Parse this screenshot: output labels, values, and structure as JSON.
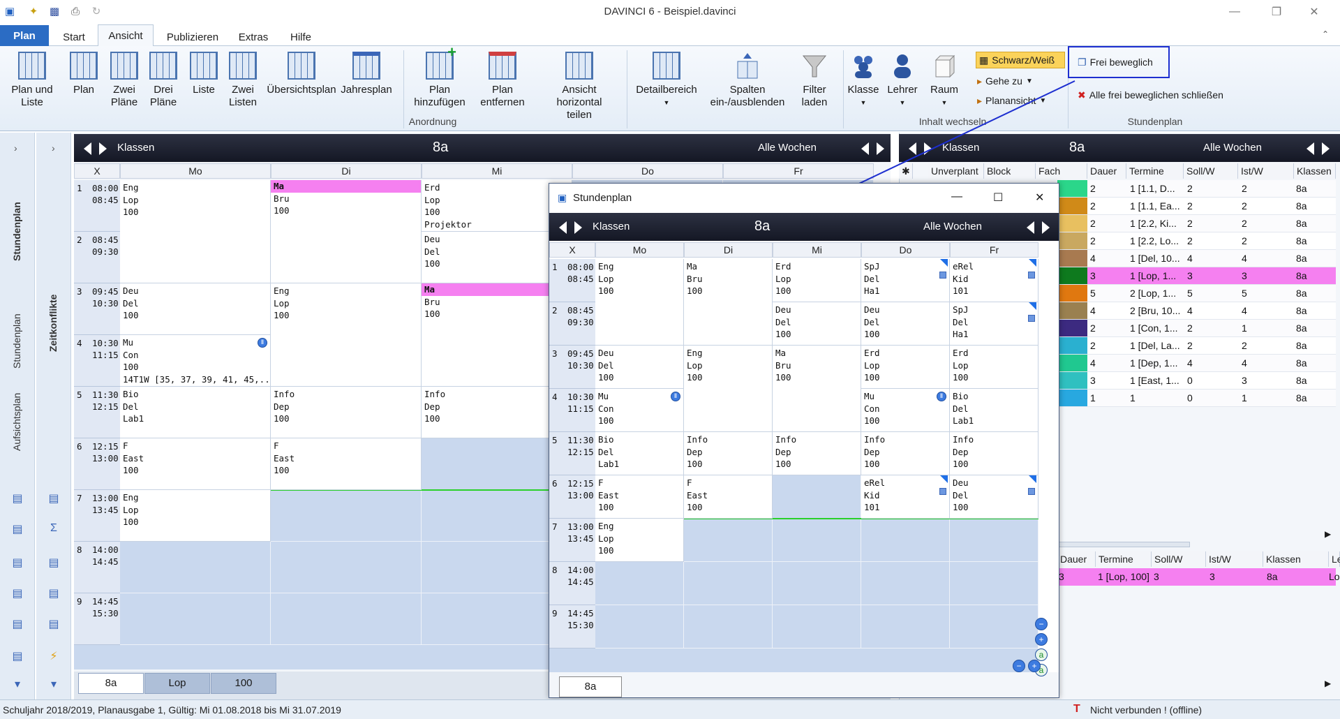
{
  "window": {
    "title": "DAVINCI 6 - Beispiel.davinci",
    "minimize": "—",
    "maximize": "❐",
    "close": "✕"
  },
  "tabs": [
    {
      "label": "Plan"
    },
    {
      "label": "Start"
    },
    {
      "label": "Ansicht"
    },
    {
      "label": "Publizieren"
    },
    {
      "label": "Extras"
    },
    {
      "label": "Hilfe"
    }
  ],
  "ribbon": {
    "buttons": [
      "Plan und\nListe",
      "Plan",
      "Zwei\nPläne",
      "Drei\nPläne",
      "Liste",
      "Zwei\nListen",
      "Übersichtsplan",
      "Jahresplan",
      "Plan\nhinzufügen",
      "Plan\nentfernen",
      "Ansicht\nhorizontal teilen",
      "Detailbereich",
      "Spalten\nein-/ausblenden",
      "Filter\nladen",
      "Klasse",
      "Lehrer",
      "Raum"
    ],
    "group_anordnung": "Anordnung",
    "group_inhalt": "Inhalt wechseln",
    "group_stundenplan": "Stundenplan",
    "schwarz_weiss": "Schwarz/Weiß",
    "gehe_zu": "Gehe zu",
    "planansicht": "Planansicht",
    "frei_beweglich": "Frei beweglich",
    "alle_frei": "Alle frei beweglichen schließen"
  },
  "left": {
    "stundenplan": "Stundenplan",
    "aufsichtsplan": "Aufsichtsplan",
    "stundenplan2": "Stundenplan",
    "zeitkonflikte": "Zeitkonflikte"
  },
  "main": {
    "kind": "Klassen",
    "name": "8a",
    "weeks": "Alle Wochen",
    "days": [
      "X",
      "Mo",
      "Di",
      "Mi",
      "Do",
      "Fr"
    ],
    "slots": [
      {
        "n": "1",
        "from": "08:00",
        "to": "08:45"
      },
      {
        "n": "2",
        "from": "08:45",
        "to": "09:30"
      },
      {
        "n": "3",
        "from": "09:45",
        "to": "10:30"
      },
      {
        "n": "4",
        "from": "10:30",
        "to": "11:15"
      },
      {
        "n": "5",
        "from": "11:30",
        "to": "12:15"
      },
      {
        "n": "6",
        "from": "12:15",
        "to": "13:00"
      },
      {
        "n": "7",
        "from": "13:00",
        "to": "13:45"
      },
      {
        "n": "8",
        "from": "14:00",
        "to": "14:45"
      },
      {
        "n": "9",
        "from": "14:45",
        "to": "15:30"
      }
    ],
    "lessons": [
      {
        "d": 0,
        "s": 0,
        "h": 2,
        "lines": [
          "Eng",
          "Lop",
          "100"
        ]
      },
      {
        "d": 1,
        "s": 0,
        "h": 2,
        "pink": true,
        "lines": [
          "Ma",
          "Bru",
          "100"
        ]
      },
      {
        "d": 2,
        "s": 0,
        "h": 1,
        "lines": [
          "Erd",
          "Lop",
          "100",
          "Projektor"
        ]
      },
      {
        "d": 2,
        "s": 1,
        "h": 1,
        "lines": [
          "Deu",
          "Del",
          "100"
        ]
      },
      {
        "d": 0,
        "s": 2,
        "h": 1,
        "lines": [
          "Deu",
          "Del",
          "100"
        ]
      },
      {
        "d": 1,
        "s": 2,
        "h": 2,
        "lines": [
          "Eng",
          "Lop",
          "100"
        ]
      },
      {
        "d": 2,
        "s": 2,
        "h": 2,
        "pink": true,
        "lines": [
          "Ma",
          "Bru",
          "100"
        ]
      },
      {
        "d": 0,
        "s": 3,
        "h": 1,
        "badge": true,
        "lines": [
          "Mu",
          "Con",
          "100",
          "14T1W [35, 37, 39, 41, 45,..."
        ]
      },
      {
        "d": 0,
        "s": 4,
        "h": 1,
        "lines": [
          "Bio",
          "Del",
          "Lab1"
        ]
      },
      {
        "d": 1,
        "s": 4,
        "h": 1,
        "lines": [
          "Info",
          "Dep",
          "100"
        ]
      },
      {
        "d": 2,
        "s": 4,
        "h": 1,
        "lines": [
          "Info",
          "Dep",
          "100"
        ]
      },
      {
        "d": 0,
        "s": 5,
        "h": 1,
        "lines": [
          "F",
          "East",
          "100"
        ]
      },
      {
        "d": 1,
        "s": 5,
        "h": 1,
        "lines": [
          "F",
          "East",
          "100"
        ]
      },
      {
        "d": 0,
        "s": 6,
        "h": 1,
        "lines": [
          "Eng",
          "Lop",
          "100"
        ]
      }
    ],
    "bottom_tabs": [
      "8a",
      "Lop",
      "100"
    ]
  },
  "right": {
    "kind": "Klassen",
    "name": "8a",
    "weeks": "Alle Wochen",
    "cols": [
      "Unverplant",
      "Block",
      "Fach",
      "Dauer",
      "Termine",
      "Soll/W",
      "Ist/W",
      "Klassen"
    ],
    "rows": [
      {
        "color": "#2bd68a",
        "dauer": "2",
        "termine": "1 [1.1, D...",
        "soll": "2",
        "ist": "2",
        "kl": "8a"
      },
      {
        "color": "#d08a18",
        "dauer": "2",
        "termine": "1 [1.1, Ea...",
        "soll": "2",
        "ist": "2",
        "kl": "8a"
      },
      {
        "color": "#e8c060",
        "dauer": "2",
        "termine": "1 [2.2, Ki...",
        "soll": "2",
        "ist": "2",
        "kl": "8a"
      },
      {
        "color": "#c9a860",
        "dauer": "2",
        "termine": "1 [2.2, Lo...",
        "soll": "2",
        "ist": "2",
        "kl": "8a"
      },
      {
        "color": "#a87a50",
        "dauer": "4",
        "termine": "1 [Del, 10...",
        "soll": "4",
        "ist": "4",
        "kl": "8a"
      },
      {
        "color": "#0e7a1e",
        "dauer": "3",
        "termine": "1 [Lop, 1...",
        "soll": "3",
        "ist": "3",
        "kl": "8a",
        "pink": true
      },
      {
        "color": "#e07810",
        "dauer": "5",
        "termine": "2 [Lop, 1...",
        "soll": "5",
        "ist": "5",
        "kl": "8a"
      },
      {
        "color": "#9a8050",
        "dauer": "4",
        "termine": "2 [Bru, 10...",
        "soll": "4",
        "ist": "4",
        "kl": "8a"
      },
      {
        "color": "#3c2a80",
        "dauer": "2",
        "termine": "1 [Con, 1...",
        "soll": "2",
        "ist": "1",
        "kl": "8a"
      },
      {
        "color": "#2ab0d0",
        "dauer": "2",
        "termine": "1 [Del, La...",
        "soll": "2",
        "ist": "2",
        "kl": "8a"
      },
      {
        "color": "#20c890",
        "dauer": "4",
        "termine": "1 [Dep, 1...",
        "soll": "4",
        "ist": "4",
        "kl": "8a"
      },
      {
        "color": "#30c0c0",
        "dauer": "3",
        "termine": "1 [East, 1...",
        "soll": "0",
        "ist": "3",
        "kl": "8a"
      },
      {
        "color": "#28a8e0",
        "dauer": "1",
        "termine": "1",
        "soll": "0",
        "ist": "1",
        "kl": "8a"
      }
    ],
    "bottom_cols": [
      "Dauer",
      "Termine",
      "Soll/W",
      "Ist/W",
      "Klassen",
      "Le"
    ],
    "bottom_row": {
      "dauer": "3",
      "termine": "1 [Lop, 100]",
      "soll": "3",
      "ist": "3",
      "kl": "8a",
      "le": "Lo"
    }
  },
  "float": {
    "title": "Stundenplan",
    "kind": "Klassen",
    "name": "8a",
    "weeks": "Alle Wochen",
    "days": [
      "X",
      "Mo",
      "Di",
      "Mi",
      "Do",
      "Fr"
    ],
    "lessons": [
      {
        "d": 0,
        "s": 0,
        "h": 2,
        "lines": [
          "Eng",
          "Lop",
          "100"
        ]
      },
      {
        "d": 1,
        "s": 0,
        "h": 2,
        "lines": [
          "Ma",
          "Bru",
          "100"
        ]
      },
      {
        "d": 2,
        "s": 0,
        "h": 1,
        "lines": [
          "Erd",
          "Lop",
          "100"
        ]
      },
      {
        "d": 2,
        "s": 1,
        "h": 1,
        "lines": [
          "Deu",
          "Del",
          "100"
        ]
      },
      {
        "d": 3,
        "s": 0,
        "h": 1,
        "corner": true,
        "lines": [
          "SpJ",
          "Del",
          "Ha1"
        ]
      },
      {
        "d": 3,
        "s": 1,
        "h": 1,
        "lines": [
          "Deu",
          "Del",
          "100"
        ]
      },
      {
        "d": 4,
        "s": 0,
        "h": 1,
        "corner": true,
        "lines": [
          "eRel",
          "Kid",
          "101"
        ]
      },
      {
        "d": 4,
        "s": 1,
        "h": 1,
        "corner": true,
        "lines": [
          "SpJ",
          "Del",
          "Ha1"
        ]
      },
      {
        "d": 0,
        "s": 2,
        "h": 1,
        "lines": [
          "Deu",
          "Del",
          "100"
        ]
      },
      {
        "d": 1,
        "s": 2,
        "h": 2,
        "lines": [
          "Eng",
          "Lop",
          "100"
        ]
      },
      {
        "d": 2,
        "s": 2,
        "h": 2,
        "lines": [
          "Ma",
          "Bru",
          "100"
        ]
      },
      {
        "d": 3,
        "s": 2,
        "h": 1,
        "lines": [
          "Erd",
          "Lop",
          "100"
        ]
      },
      {
        "d": 4,
        "s": 2,
        "h": 1,
        "lines": [
          "Erd",
          "Lop",
          "100"
        ]
      },
      {
        "d": 0,
        "s": 3,
        "h": 1,
        "badge": true,
        "lines": [
          "Mu",
          "Con",
          "100"
        ]
      },
      {
        "d": 3,
        "s": 3,
        "h": 1,
        "badge": true,
        "lines": [
          "Mu",
          "Con",
          "100"
        ]
      },
      {
        "d": 4,
        "s": 3,
        "h": 1,
        "lines": [
          "Bio",
          "Del",
          "Lab1"
        ]
      },
      {
        "d": 0,
        "s": 4,
        "h": 1,
        "lines": [
          "Bio",
          "Del",
          "Lab1"
        ]
      },
      {
        "d": 1,
        "s": 4,
        "h": 1,
        "lines": [
          "Info",
          "Dep",
          "100"
        ]
      },
      {
        "d": 2,
        "s": 4,
        "h": 1,
        "lines": [
          "Info",
          "Dep",
          "100"
        ]
      },
      {
        "d": 3,
        "s": 4,
        "h": 1,
        "lines": [
          "Info",
          "Dep",
          "100"
        ]
      },
      {
        "d": 4,
        "s": 4,
        "h": 1,
        "lines": [
          "Info",
          "Dep",
          "100"
        ]
      },
      {
        "d": 0,
        "s": 5,
        "h": 1,
        "lines": [
          "F",
          "East",
          "100"
        ]
      },
      {
        "d": 1,
        "s": 5,
        "h": 1,
        "lines": [
          "F",
          "East",
          "100"
        ]
      },
      {
        "d": 3,
        "s": 5,
        "h": 1,
        "corner": true,
        "lines": [
          "eRel",
          "Kid",
          "101"
        ]
      },
      {
        "d": 4,
        "s": 5,
        "h": 1,
        "corner": true,
        "lines": [
          "Deu",
          "Del",
          "100"
        ]
      },
      {
        "d": 0,
        "s": 6,
        "h": 1,
        "lines": [
          "Eng",
          "Lop",
          "100"
        ]
      }
    ],
    "bottom_tab": "8a"
  },
  "status": {
    "left": "Schuljahr 2018/2019, Planausgabe 1, Gültig: Mi 01.08.2018 bis Mi 31.07.2019",
    "right": "Nicht verbunden ! (offline)"
  }
}
